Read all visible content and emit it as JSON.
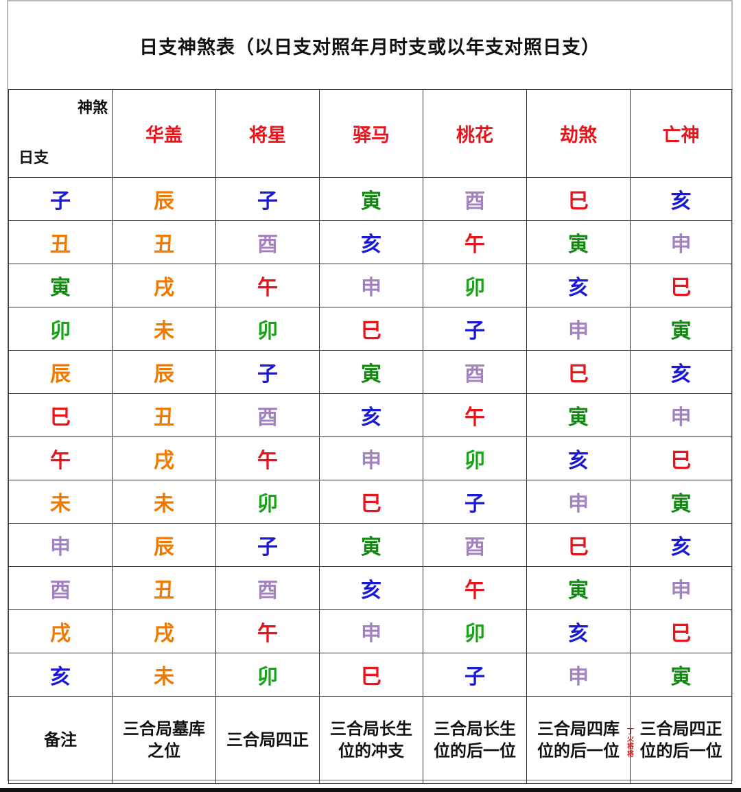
{
  "title": "日支神煞表（以日支对照年月时支或以年支对照日支）",
  "corner": {
    "top": "神煞",
    "bottom": "日支"
  },
  "colors": {
    "子": "#1a1ad6",
    "丑": "#f07a00",
    "寅": "#128a12",
    "卯": "#1aa31a",
    "辰": "#f07a00",
    "巳": "#e8141b",
    "午": "#e8141b",
    "未": "#f07a00",
    "申": "#a283c0",
    "酉": "#a283c0",
    "戌": "#f07a00",
    "亥": "#1a1ad6",
    "header": "#e8141b"
  },
  "headers": [
    "华盖",
    "将星",
    "驿马",
    "桃花",
    "劫煞",
    "亡神"
  ],
  "rows": [
    {
      "branch": "子",
      "values": [
        "辰",
        "子",
        "寅",
        "酉",
        "巳",
        "亥"
      ]
    },
    {
      "branch": "丑",
      "values": [
        "丑",
        "酉",
        "亥",
        "午",
        "寅",
        "申"
      ]
    },
    {
      "branch": "寅",
      "values": [
        "戌",
        "午",
        "申",
        "卯",
        "亥",
        "巳"
      ]
    },
    {
      "branch": "卯",
      "values": [
        "未",
        "卯",
        "巳",
        "子",
        "申",
        "寅"
      ]
    },
    {
      "branch": "辰",
      "values": [
        "辰",
        "子",
        "寅",
        "酉",
        "巳",
        "亥"
      ]
    },
    {
      "branch": "巳",
      "values": [
        "丑",
        "酉",
        "亥",
        "午",
        "寅",
        "申"
      ]
    },
    {
      "branch": "午",
      "values": [
        "戌",
        "午",
        "申",
        "卯",
        "亥",
        "巳"
      ]
    },
    {
      "branch": "未",
      "values": [
        "未",
        "卯",
        "巳",
        "子",
        "申",
        "寅"
      ]
    },
    {
      "branch": "申",
      "values": [
        "辰",
        "子",
        "寅",
        "酉",
        "巳",
        "亥"
      ]
    },
    {
      "branch": "酉",
      "values": [
        "丑",
        "酉",
        "亥",
        "午",
        "寅",
        "申"
      ]
    },
    {
      "branch": "戌",
      "values": [
        "戌",
        "午",
        "申",
        "卯",
        "亥",
        "巳"
      ]
    },
    {
      "branch": "亥",
      "values": [
        "未",
        "卯",
        "巳",
        "子",
        "申",
        "寅"
      ]
    }
  ],
  "notes": {
    "label": "备注",
    "items": [
      [
        "三合局墓库",
        "之位"
      ],
      [
        "三合局四正"
      ],
      [
        "三合局长生",
        "位的冲支"
      ],
      [
        "三合局长生",
        "位的后一位"
      ],
      [
        "三合局四库",
        "位的后一位"
      ],
      [
        "三合局四正",
        "位的后一位"
      ]
    ],
    "side_annotation": "丁火将将"
  }
}
